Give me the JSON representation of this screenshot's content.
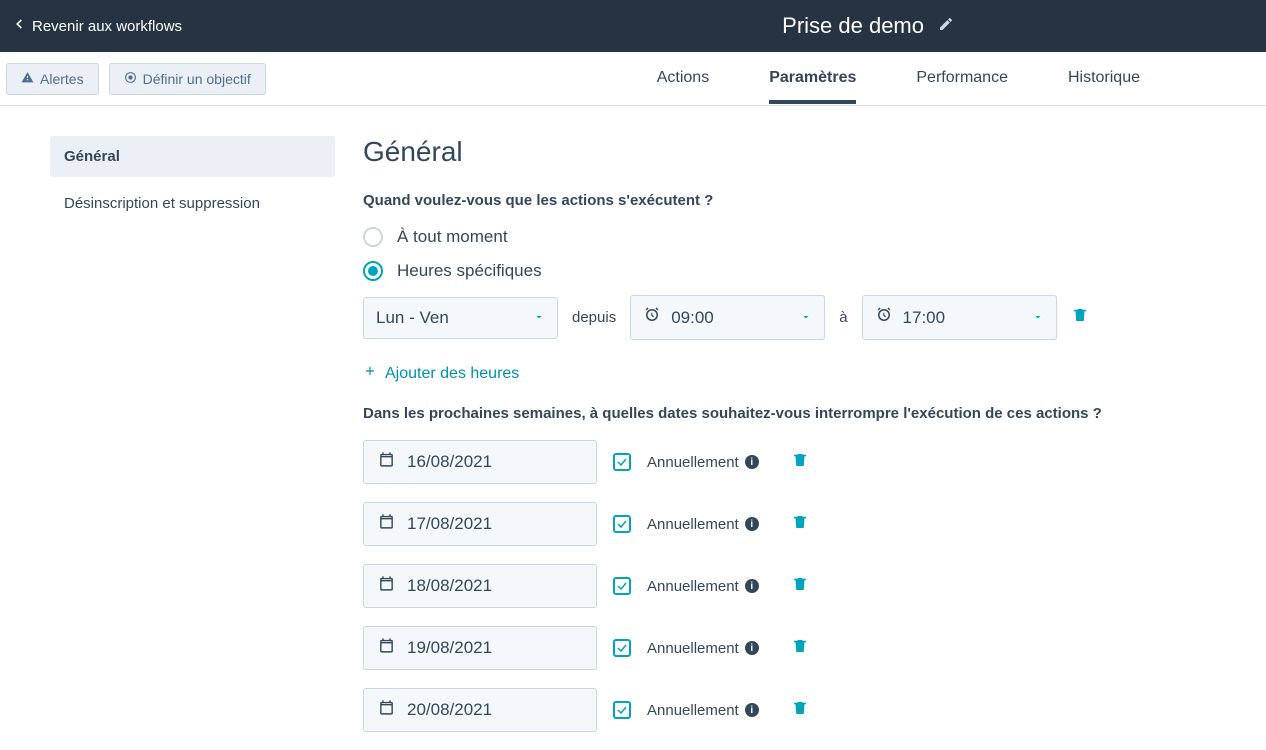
{
  "header": {
    "back_label": "Revenir aux workflows",
    "page_title": "Prise de demo"
  },
  "subheader": {
    "alerts_label": "Alertes",
    "goal_label": "Définir un objectif"
  },
  "tabs": {
    "actions": "Actions",
    "parametres": "Paramètres",
    "performance": "Performance",
    "historique": "Historique"
  },
  "sidebar": {
    "general": "Général",
    "unsubscribe": "Désinscription et suppression"
  },
  "main": {
    "heading": "Général",
    "q1": "Quand voulez-vous que les actions s'exécutent ?",
    "opt_anytime": "À tout moment",
    "opt_specific": "Heures spécifiques",
    "day_range": "Lun - Ven",
    "from_label": "depuis",
    "time_start": "09:00",
    "to_label": "à",
    "time_end": "17:00",
    "add_hours": "Ajouter des heures",
    "q2": "Dans les prochaines semaines, à quelles dates souhaitez-vous interrompre l'exécution de ces actions ?",
    "annual_label": "Annuellement",
    "dates": [
      {
        "value": "16/08/2021"
      },
      {
        "value": "17/08/2021"
      },
      {
        "value": "18/08/2021"
      },
      {
        "value": "19/08/2021"
      },
      {
        "value": "20/08/2021"
      }
    ]
  }
}
